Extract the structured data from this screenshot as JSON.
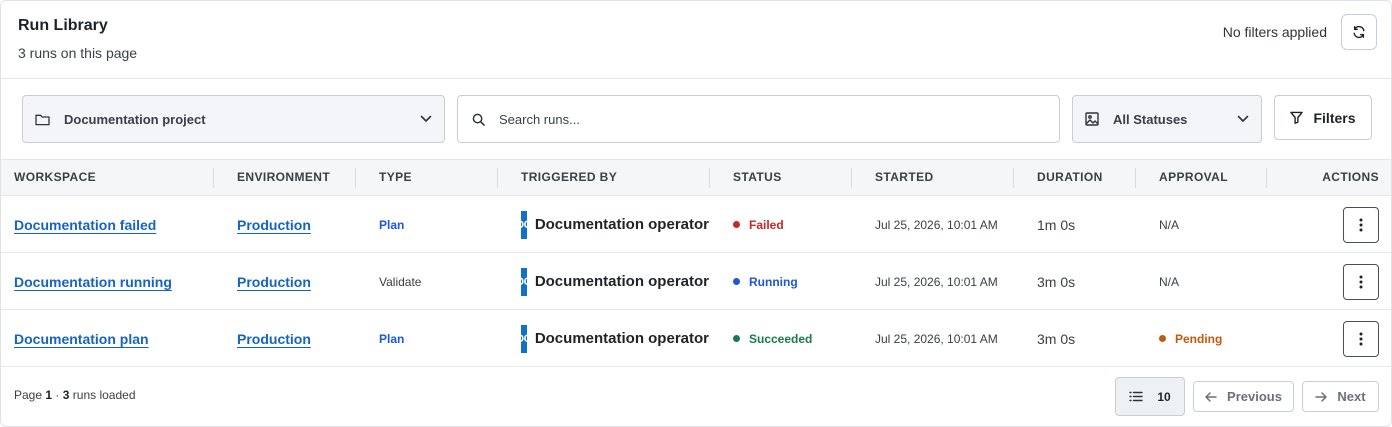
{
  "header": {
    "title": "Run Library",
    "subtitle": "3 runs on this page",
    "filter_state": "No filters applied"
  },
  "toolbar": {
    "project_label": "Documentation project",
    "search_placeholder": "Search runs...",
    "status_label": "All Statuses",
    "filters_label": "Filters"
  },
  "table": {
    "columns": [
      "WORKSPACE",
      "ENVIRONMENT",
      "TYPE",
      "TRIGGERED BY",
      "STATUS",
      "STARTED",
      "DURATION",
      "APPROVAL",
      "ACTIONS"
    ],
    "rows": [
      {
        "workspace": "Documentation failed",
        "environment": "Production",
        "type": "Plan",
        "avatar": "DO",
        "triggered_by": "Documentation operator",
        "status": "Failed",
        "status_color": "#c62828",
        "started": "Jul 25, 2026, 10:01 AM",
        "duration": "1m 0s",
        "approval": "N/A",
        "approval_color": "#3a3f46"
      },
      {
        "workspace": "Documentation running",
        "environment": "Production",
        "type": "Validate",
        "avatar": "DO",
        "triggered_by": "Documentation operator",
        "status": "Running",
        "status_color": "#1f56d6",
        "started": "Jul 25, 2026, 10:01 AM",
        "duration": "3m 0s",
        "approval": "N/A",
        "approval_color": "#3a3f46"
      },
      {
        "workspace": "Documentation plan",
        "environment": "Production",
        "type": "Plan",
        "avatar": "DO",
        "triggered_by": "Documentation operator",
        "status": "Succeeded",
        "status_color": "#1b7a4b",
        "started": "Jul 25, 2026, 10:01 AM",
        "duration": "3m 0s",
        "approval": "Pending",
        "approval_color": "#c25a0c"
      }
    ]
  },
  "footer": {
    "page_label": "Page",
    "page_number": "1",
    "separator": "·",
    "loaded_count": "3",
    "loaded_label": "runs loaded",
    "page_size": "10",
    "previous_label": "Previous",
    "next_label": "Next"
  },
  "icons": {
    "refresh": "refresh-icon",
    "folder": "folder-icon",
    "search": "search-icon",
    "image": "image-icon",
    "filter": "filter-icon",
    "chevron": "chevron-down-icon",
    "kebab": "more-vertical-icon",
    "list": "list-icon",
    "arrow_left": "arrow-left-icon",
    "arrow_right": "arrow-right-icon"
  }
}
